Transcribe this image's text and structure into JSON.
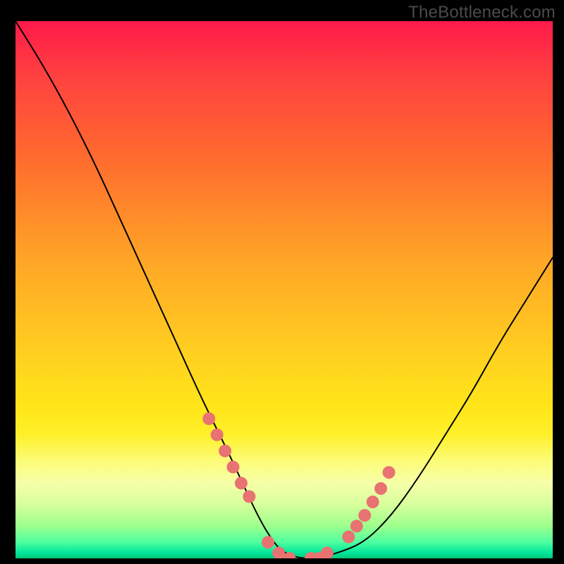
{
  "attribution": "TheBottleneck.com",
  "chart_data": {
    "type": "line",
    "title": "",
    "xlabel": "",
    "ylabel": "",
    "xlim": [
      0,
      100
    ],
    "ylim": [
      0,
      100
    ],
    "curve": {
      "x": [
        0,
        5,
        10,
        15,
        20,
        25,
        30,
        35,
        40,
        45,
        48,
        50,
        53,
        56,
        60,
        65,
        70,
        75,
        80,
        85,
        90,
        95,
        100
      ],
      "y_pct": [
        100,
        92,
        83,
        73,
        62,
        51,
        40,
        29,
        19,
        8,
        3,
        1,
        0,
        0,
        1,
        3,
        8,
        15,
        23,
        31,
        40,
        48,
        56
      ]
    },
    "markers": {
      "x": [
        36,
        37.5,
        39,
        40.5,
        42,
        43.5,
        47,
        49,
        51,
        55,
        56.5,
        58,
        62,
        63.5,
        65,
        66.5,
        68,
        69.5
      ],
      "y_pct": [
        26,
        23,
        20,
        17,
        14,
        11.5,
        3,
        1,
        0,
        0,
        0,
        1,
        4,
        6,
        8,
        10.5,
        13,
        16
      ],
      "color": "#e97272",
      "radius": 9
    },
    "gradient_stops": [
      {
        "pos": 0,
        "color": "#ff1a4a"
      },
      {
        "pos": 10,
        "color": "#ff4040"
      },
      {
        "pos": 25,
        "color": "#ff6a2e"
      },
      {
        "pos": 45,
        "color": "#ffa726"
      },
      {
        "pos": 63,
        "color": "#ffd21f"
      },
      {
        "pos": 72,
        "color": "#ffe619"
      },
      {
        "pos": 77,
        "color": "#fff02a"
      },
      {
        "pos": 82,
        "color": "#fcfc7a"
      },
      {
        "pos": 86,
        "color": "#f6ffa8"
      },
      {
        "pos": 90,
        "color": "#d7ff9c"
      },
      {
        "pos": 94,
        "color": "#9dff8c"
      },
      {
        "pos": 97,
        "color": "#4dffa0"
      },
      {
        "pos": 99,
        "color": "#00e59a"
      },
      {
        "pos": 100,
        "color": "#00c77a"
      }
    ]
  }
}
